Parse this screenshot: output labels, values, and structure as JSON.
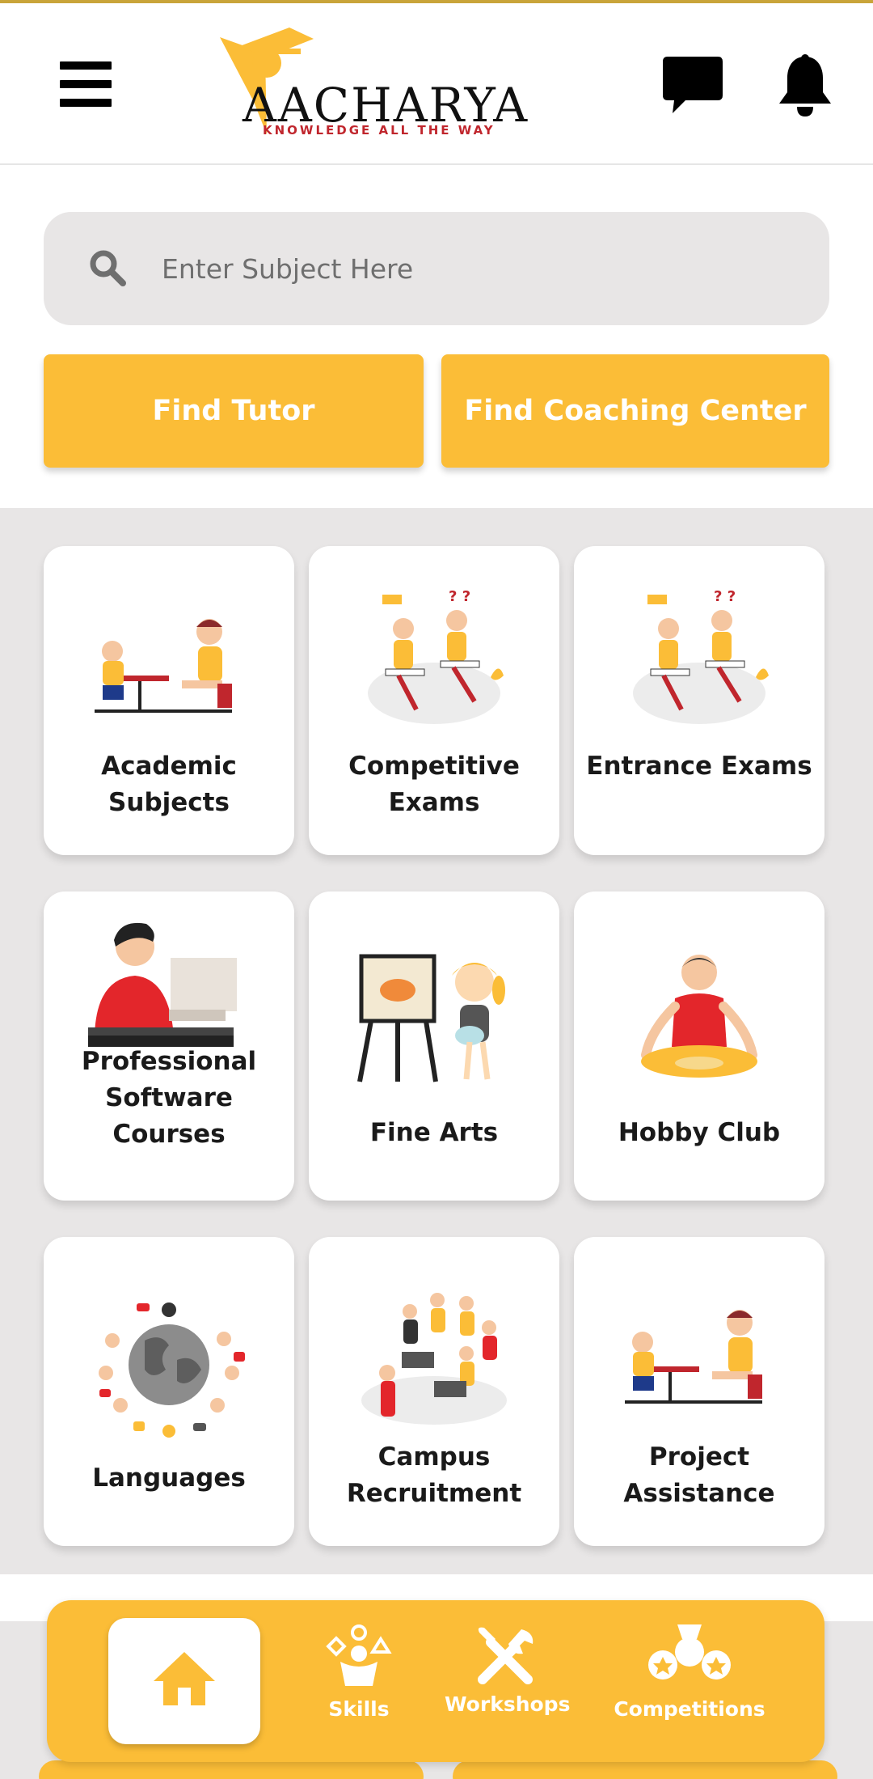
{
  "header": {
    "logo_text": "AACHARYA",
    "logo_tagline": "KNOWLEDGE ALL THE WAY",
    "menu_icon": "hamburger-icon",
    "chat_icon": "chat-bubble-icon",
    "bell_icon": "bell-icon"
  },
  "search": {
    "placeholder": "Enter Subject Here",
    "value": ""
  },
  "actions": {
    "find_tutor": "Find Tutor",
    "find_coaching": "Find Coaching Center"
  },
  "categories": [
    {
      "label": "Academic Subjects"
    },
    {
      "label": "Competitive Exams"
    },
    {
      "label": "Entrance Exams"
    },
    {
      "label": "Professional Software Courses"
    },
    {
      "label": "Fine Arts"
    },
    {
      "label": "Hobby Club"
    },
    {
      "label": "Languages"
    },
    {
      "label": "Campus Recruitment"
    },
    {
      "label": "Project Assistance"
    }
  ],
  "bottom_nav": {
    "home_icon": "home-icon",
    "items": [
      {
        "label": "Skills"
      },
      {
        "label": "Workshops"
      },
      {
        "label": "Competitions"
      }
    ]
  },
  "colors": {
    "accent": "#fbbd37",
    "background_grey": "#e8e6e6",
    "text_dark": "#1a1a1a",
    "tagline_red": "#c0262d"
  }
}
